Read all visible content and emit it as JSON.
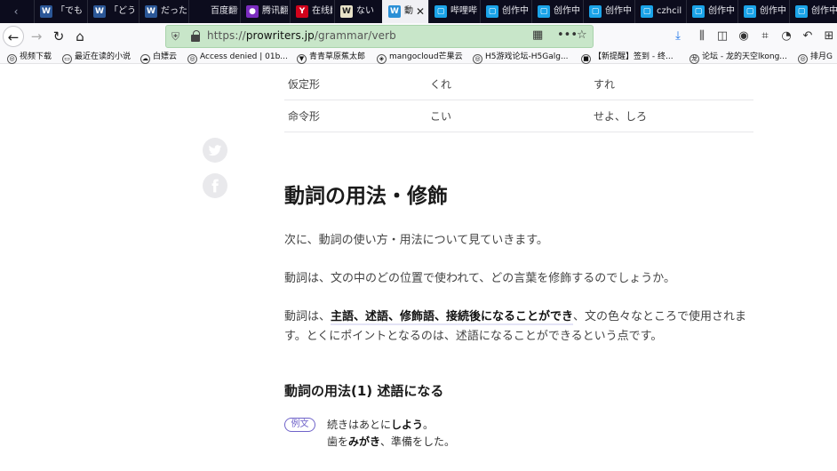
{
  "browser": {
    "tabs": [
      {
        "fav": "W",
        "fav_color": "#2b5797",
        "label": "「でも"
      },
      {
        "fav": "W",
        "fav_color": "#2b5797",
        "label": "「どう"
      },
      {
        "fav": "W",
        "fav_color": "#2b5797",
        "label": "だった"
      },
      {
        "fav": "",
        "fav_color": "#0c0c1d",
        "label": "百度翻译"
      },
      {
        "fav": "●",
        "fav_color": "#7b2cbf",
        "label": "腾讯翻"
      },
      {
        "fav": "Y",
        "fav_color": "#d0021b",
        "label": "在线翻"
      },
      {
        "fav": "W",
        "fav_color": "#e8e2c8",
        "label": "ない"
      },
      {
        "fav": "W",
        "fav_color": "#2b8fd6",
        "label": "動",
        "active": true
      },
      {
        "fav": "▢",
        "fav_color": "#1aa3e8",
        "label": "哔哩哔"
      },
      {
        "fav": "▢",
        "fav_color": "#1aa3e8",
        "label": "创作中"
      },
      {
        "fav": "▢",
        "fav_color": "#1aa3e8",
        "label": "创作中"
      },
      {
        "fav": "▢",
        "fav_color": "#1aa3e8",
        "label": "创作中"
      },
      {
        "fav": "▢",
        "fav_color": "#1aa3e8",
        "label": "czhcil"
      },
      {
        "fav": "▢",
        "fav_color": "#1aa3e8",
        "label": "创作中"
      },
      {
        "fav": "▢",
        "fav_color": "#1aa3e8",
        "label": "创作中"
      },
      {
        "fav": "▢",
        "fav_color": "#1aa3e8",
        "label": "创作中"
      }
    ],
    "url_prefix": "https://",
    "url_domain": "prowriters.jp",
    "url_path": "/grammar/verb",
    "bookmarks": [
      {
        "icon": "◎",
        "label": "视频下载"
      },
      {
        "icon": "▭",
        "label": "最近在读的小说"
      },
      {
        "icon": "☁",
        "label": "白嫖云"
      },
      {
        "icon": "◎",
        "label": "Access denied | 01b..."
      },
      {
        "icon": "▼",
        "label": "青青草原蕉太郎"
      },
      {
        "icon": "◈",
        "label": "mangocloud芒果云"
      },
      {
        "icon": "◎",
        "label": "H5游戏论坛-H5Galg..."
      },
      {
        "icon": "■",
        "label": "【新提醒】签到 - 终..."
      },
      {
        "icon": "龙",
        "label": "论坛 - 龙的天空lkong..."
      },
      {
        "icon": "◎",
        "label": "排月G"
      }
    ]
  },
  "conjugation_table": [
    {
      "form": "仮定形",
      "godan": "くれ",
      "sahen": "すれ"
    },
    {
      "form": "命令形",
      "godan": "こい",
      "sahen": "せよ、しろ"
    }
  ],
  "article": {
    "heading": "動詞の用法・修飾",
    "para1": "次に、動詞の使い方・用法について見ていきます。",
    "para2": "動詞は、文の中のどの位置で使われて、どの言葉を修飾するのでしょうか。",
    "para3_before": "動詞は、",
    "para3_bold": "主語、述語、修飾語、接続後になることができ",
    "para3_after": "、文の色々なところで使用されます。とくにポイントとなるのは、述語になることができるという点です。",
    "subheading": "動詞の用法(1) 述語になる",
    "example_badge": "例文",
    "ex1_before": "続きはあとに",
    "ex1_bold": "しよう",
    "ex1_after": "。",
    "ex2_before": "歯を",
    "ex2_bold": "みがき",
    "ex2_after": "、準備をした。"
  }
}
